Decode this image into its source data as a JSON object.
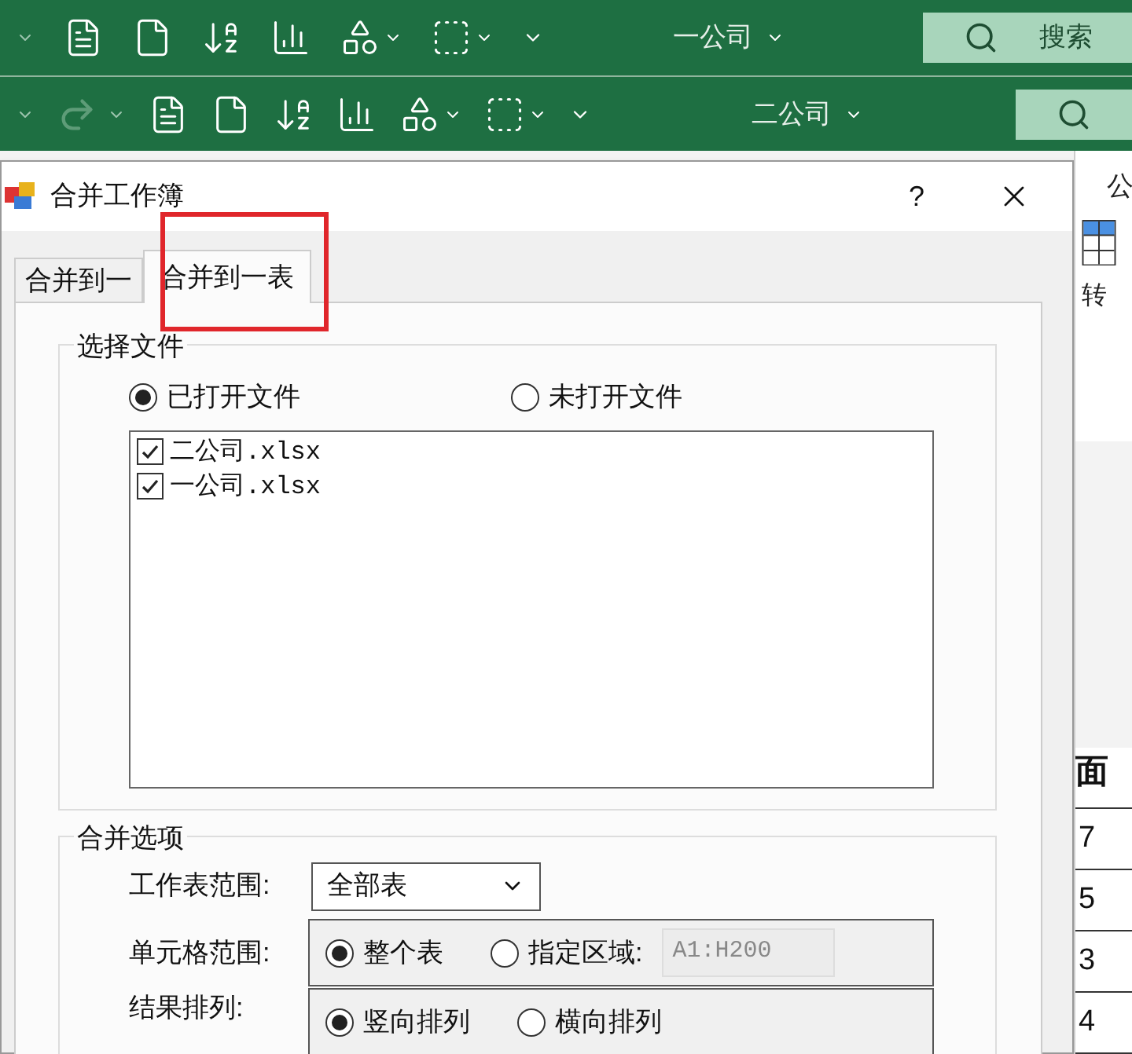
{
  "ribbons": [
    {
      "title": "一公司",
      "search_placeholder": "搜索"
    },
    {
      "title": "二公司",
      "redo_disabled": true
    }
  ],
  "background_sheet": {
    "ribbon_text": "公",
    "button_label": "转",
    "header": "面",
    "cells": [
      "7",
      "5",
      "3",
      "4"
    ]
  },
  "dialog": {
    "title": "合并工作簿",
    "help": "?",
    "tabs": [
      {
        "label": "合并到一",
        "selected": false
      },
      {
        "label": "合并到一表",
        "selected": true
      }
    ],
    "file_group": {
      "title": "选择文件",
      "options": [
        {
          "label": "已打开文件",
          "selected": true
        },
        {
          "label": "未打开文件",
          "selected": false
        }
      ],
      "files": [
        {
          "name": "二公司.xlsx",
          "checked": true
        },
        {
          "name": "一公司.xlsx",
          "checked": true
        }
      ]
    },
    "options_group": {
      "title": "合并选项",
      "sheet_range": {
        "label": "工作表范围:",
        "value": "全部表"
      },
      "cell_range": {
        "label": "单元格范围:",
        "options": [
          {
            "label": "整个表",
            "selected": true
          },
          {
            "label": "指定区域:",
            "selected": false
          }
        ],
        "range_value": "A1:H200"
      },
      "result_order": {
        "label": "结果排列:",
        "options": [
          {
            "label": "竖向排列",
            "selected": true
          },
          {
            "label": "横向排列",
            "selected": false
          }
        ]
      }
    }
  }
}
